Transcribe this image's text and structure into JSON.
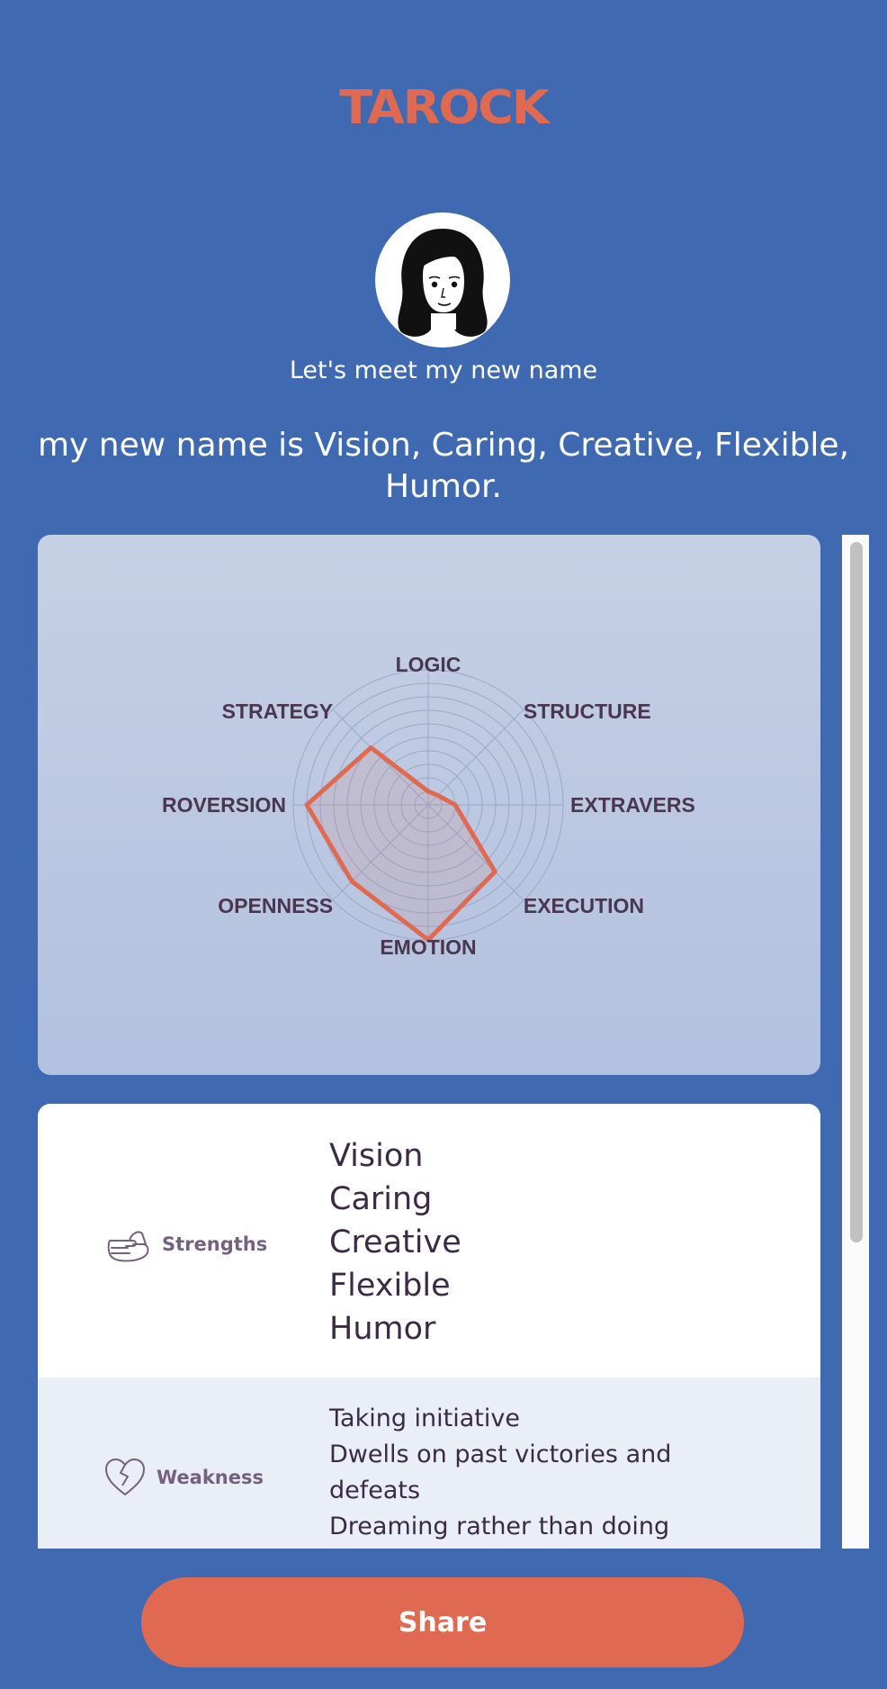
{
  "brand": {
    "logo_text": "TAROCK",
    "logo_color": "#e06a51"
  },
  "profile": {
    "subtitle": "Let's meet my new name",
    "name_line": "my new name is Vision, Caring, Creative, Flexible, Humor."
  },
  "chart_data": {
    "type": "radar",
    "categories": [
      "LOGIC",
      "STRUCTURE",
      "EXTRAVERS",
      "EXECUTION",
      "EMOTION",
      "OPENNESS",
      "ROVERSION",
      "STRATEGY"
    ],
    "values": [
      1,
      1,
      2,
      7,
      10,
      8,
      9,
      6
    ],
    "range": [
      0,
      10
    ],
    "grid_rings": 10,
    "series_color": "#e06a51"
  },
  "traits": {
    "strengths": {
      "label": "Strengths",
      "icon": "hand-pointing-icon",
      "items": [
        "Vision",
        "Caring",
        "Creative",
        "Flexible",
        "Humor"
      ]
    },
    "weakness": {
      "label": "Weakness",
      "icon": "broken-heart-icon",
      "items": [
        "Taking initiative",
        "Dwells on past victories and defeats",
        "Dreaming rather than doing"
      ]
    }
  },
  "actions": {
    "share_label": "Share"
  },
  "colors": {
    "background": "#3f69b0",
    "accent": "#e06a51",
    "text_dark": "#3b2a45"
  }
}
